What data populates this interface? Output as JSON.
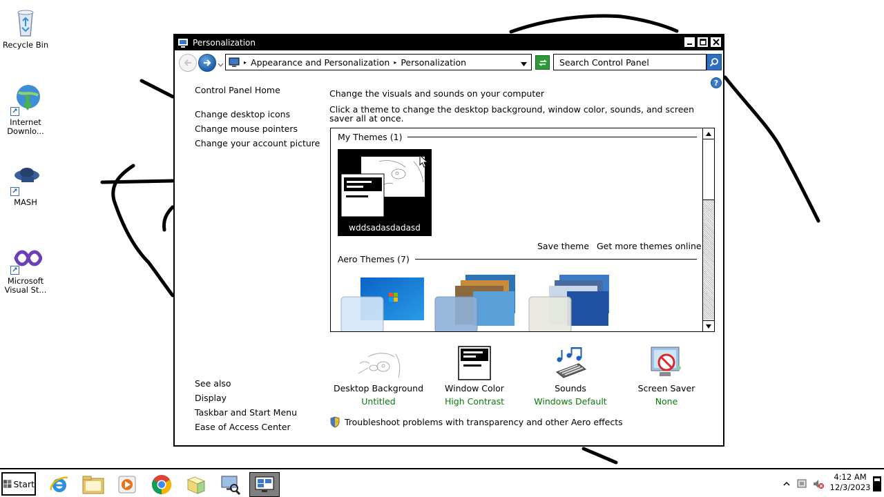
{
  "desktop": {
    "icons": [
      {
        "label": "Recycle Bin",
        "icon": "recycle-bin-icon"
      },
      {
        "label": "Internet Downlo...",
        "icon": "internet-download-manager-icon"
      },
      {
        "label": "MASH",
        "icon": "mash-icon"
      },
      {
        "label": "Microsoft Visual St...",
        "icon": "visual-studio-icon"
      }
    ]
  },
  "window": {
    "title": "Personalization",
    "address": {
      "crumbs": [
        "Appearance and Personalization",
        "Personalization"
      ]
    },
    "search": {
      "placeholder": "Search Control Panel"
    },
    "left_pane": {
      "home": "Control Panel Home",
      "links": [
        "Change desktop icons",
        "Change mouse pointers",
        "Change your account picture"
      ],
      "see_also": {
        "heading": "See also",
        "links": [
          "Display",
          "Taskbar and Start Menu",
          "Ease of Access Center"
        ]
      }
    },
    "main": {
      "heading": "Change the visuals and sounds on your computer",
      "intro": "Click a theme to change the desktop background, window color, sounds, and screen saver all at once.",
      "my_themes": {
        "header": "My Themes (1)",
        "themes": [
          {
            "name": "wddsadasdadasd"
          }
        ]
      },
      "save_theme": "Save theme",
      "get_more": "Get more themes online",
      "aero_themes": {
        "header": "Aero Themes (7)"
      },
      "settings": [
        {
          "label": "Desktop Background",
          "value": "Untitled",
          "icon": "desktop-background-icon"
        },
        {
          "label": "Window Color",
          "value": "High Contrast",
          "icon": "window-color-icon"
        },
        {
          "label": "Sounds",
          "value": "Windows Default",
          "icon": "sounds-icon"
        },
        {
          "label": "Screen Saver",
          "value": "None",
          "icon": "screen-saver-icon"
        }
      ],
      "troubleshoot": "Troubleshoot problems with transparency and other Aero effects"
    }
  },
  "taskbar": {
    "start_label": "Start",
    "apps": [
      "internet-explorer-icon",
      "file-explorer-icon",
      "media-player-icon",
      "chrome-icon",
      "folder-icon",
      "control-panel-icon",
      "personalization-icon"
    ],
    "active_app": "personalization-icon",
    "clock": {
      "time": "4:12 AM",
      "date": "12/3/2023"
    }
  },
  "colors": {
    "setting_value": "#0a7a0a",
    "titlebar": "#000000"
  }
}
